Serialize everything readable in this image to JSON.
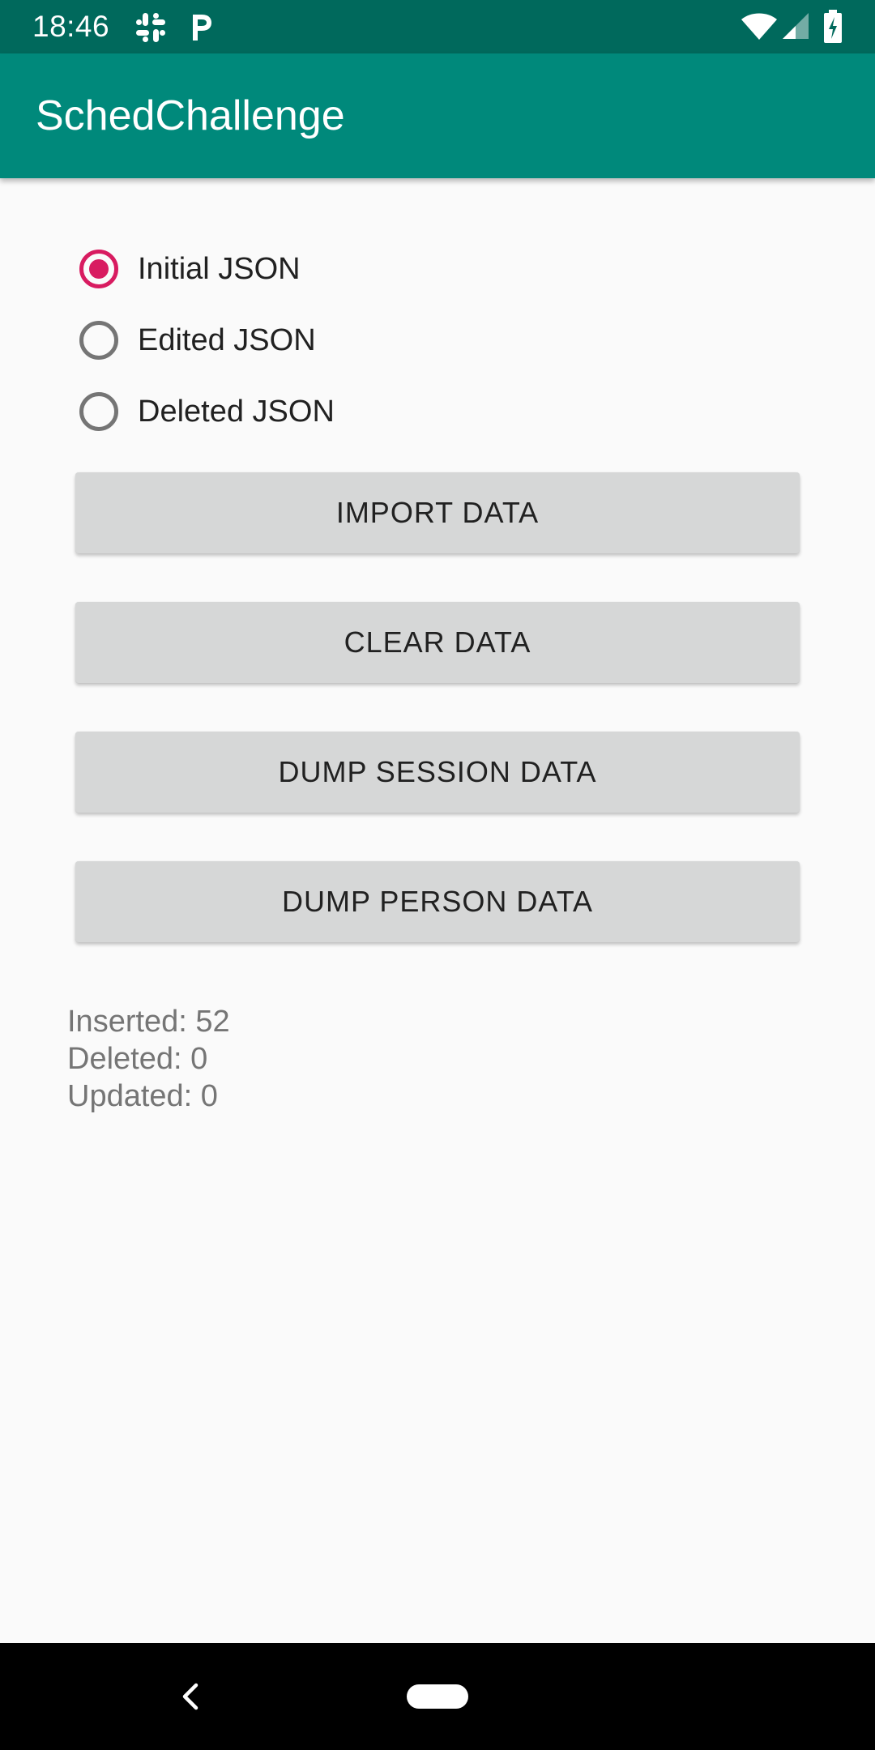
{
  "status_bar": {
    "time": "18:46",
    "icons": [
      "slack-icon",
      "p-icon",
      "wifi-icon",
      "signal-icon",
      "battery-icon"
    ]
  },
  "app_bar": {
    "title": "SchedChallenge"
  },
  "radio_options": [
    {
      "label": "Initial JSON",
      "checked": true
    },
    {
      "label": "Edited JSON",
      "checked": false
    },
    {
      "label": "Deleted JSON",
      "checked": false
    }
  ],
  "buttons": {
    "import": "IMPORT DATA",
    "clear": "CLEAR DATA",
    "dump_session": "DUMP SESSION DATA",
    "dump_person": "DUMP PERSON DATA"
  },
  "stats": {
    "inserted": "Inserted: 52",
    "deleted": "Deleted: 0",
    "updated": "Updated: 0"
  },
  "colors": {
    "status_bar": "#00695C",
    "app_bar": "#00897B",
    "accent": "#D81B60",
    "button_bg": "#D6D7D7"
  },
  "nav_bar": {
    "icons": [
      "back-icon",
      "home-pill-icon"
    ]
  }
}
